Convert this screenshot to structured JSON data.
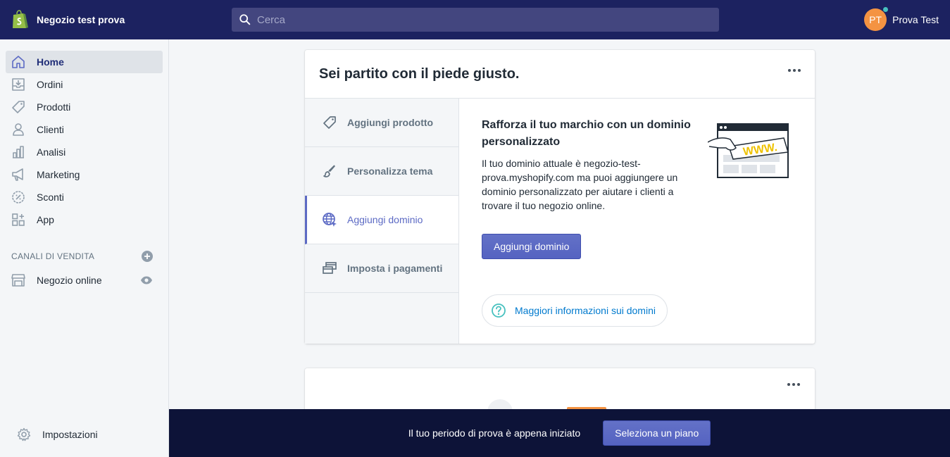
{
  "app": {
    "store_name": "Negozio test prova",
    "logo_icon": "shopify-bag-icon"
  },
  "search": {
    "placeholder": "Cerca"
  },
  "user": {
    "initials": "PT",
    "name": "Prova Test"
  },
  "sidebar": {
    "items": [
      {
        "label": "Home",
        "icon": "home-icon",
        "active": true
      },
      {
        "label": "Ordini",
        "icon": "orders-icon"
      },
      {
        "label": "Prodotti",
        "icon": "tag-icon"
      },
      {
        "label": "Clienti",
        "icon": "person-icon"
      },
      {
        "label": "Analisi",
        "icon": "bar-chart-icon"
      },
      {
        "label": "Marketing",
        "icon": "megaphone-icon"
      },
      {
        "label": "Sconti",
        "icon": "discount-icon"
      },
      {
        "label": "App",
        "icon": "apps-icon"
      }
    ],
    "channels_title": "CANALI DI VENDITA",
    "channels": [
      {
        "label": "Negozio online",
        "icon": "store-icon"
      }
    ],
    "settings_label": "Impostazioni"
  },
  "setup_card": {
    "title": "Sei partito con il piede giusto.",
    "tabs": [
      {
        "label": "Aggiungi prodotto",
        "icon": "tag-icon"
      },
      {
        "label": "Personalizza tema",
        "icon": "brush-icon"
      },
      {
        "label": "Aggiungi dominio",
        "icon": "globe-icon",
        "active": true
      },
      {
        "label": "Imposta i pagamenti",
        "icon": "payments-icon"
      }
    ],
    "pane": {
      "heading": "Rafforza il tuo marchio con un dominio personalizzato",
      "body": "Il tuo dominio attuale è negozio-test-prova.myshopify.com ma puoi aggiungere un dominio personalizzato per aiutare i clienti a trovare il tuo negozio online.",
      "button": "Aggiungi dominio",
      "info_link": "Maggiori informazioni sui domini",
      "illustration_text": "WWW."
    }
  },
  "trial_bar": {
    "text": "Il tuo periodo di prova è appena iniziato",
    "button": "Seleziona un piano"
  },
  "colors": {
    "topbar": "#1c2260",
    "accent": "#5c6ac4",
    "link": "#007ace",
    "bottombar": "#0d1338"
  }
}
